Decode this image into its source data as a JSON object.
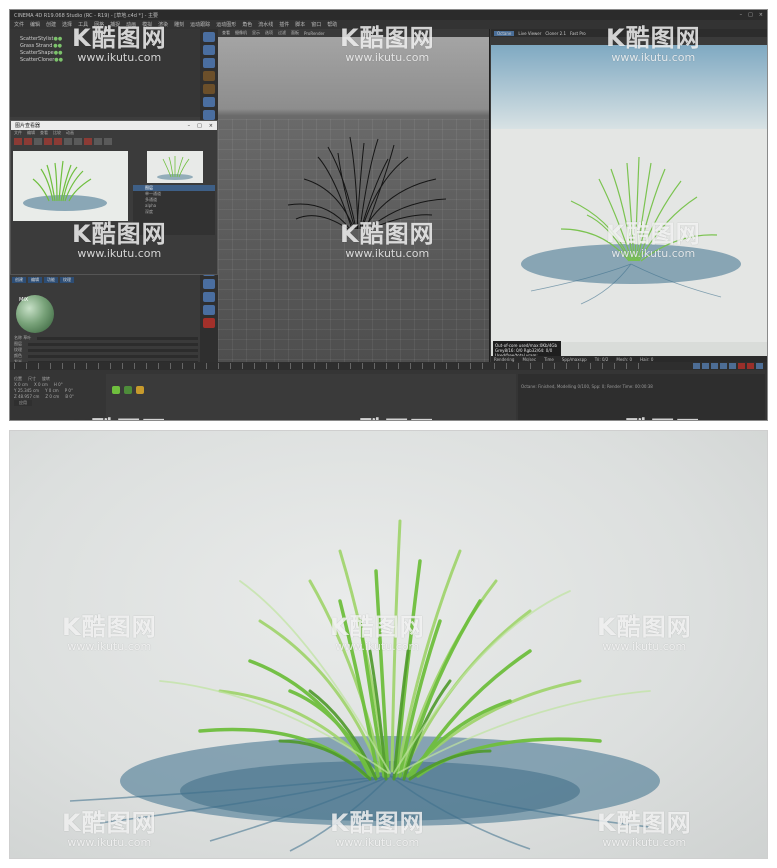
{
  "app": {
    "title": "CINEMA 4D R19.068 Studio (RC - R19) - [草地.c4d *] - 主要",
    "menus": [
      "文件",
      "编辑",
      "创建",
      "选择",
      "工具",
      "网格",
      "捕捉",
      "动画",
      "模拟",
      "渲染",
      "雕刻",
      "运动跟踪",
      "运动图形",
      "角色",
      "流水线",
      "插件",
      "脚本",
      "窗口",
      "帮助"
    ]
  },
  "object_manager": {
    "items": [
      "ScatterStylist",
      "Grass Strand",
      "ScatterShape",
      "ScatterCloner"
    ]
  },
  "picture_viewer": {
    "title": "图片查看器",
    "menu": [
      "文件",
      "编辑",
      "查看",
      "比较",
      "动画"
    ],
    "window_controls": [
      "–",
      "□",
      "×"
    ],
    "list": [
      "图层",
      "单一通道",
      "多通道",
      "alpha",
      "深度"
    ]
  },
  "material": {
    "tabs": [
      "创建",
      "编辑",
      "功能",
      "纹理"
    ],
    "label": "MIX",
    "props": [
      "名称 草叶",
      "图层",
      "纹理",
      "颜色",
      "发光"
    ]
  },
  "viewport": {
    "menu": [
      "查看",
      "摄像机",
      "显示",
      "选项",
      "过滤",
      "面板",
      "ProRender"
    ]
  },
  "render_window": {
    "tabs": [
      "Octane",
      "Live Viewer",
      "Cloner 2.1",
      "Fast Pro"
    ],
    "info_lines": [
      "Out-of-core used/max:0Kb/4Gb",
      "Grey8/16: 0/0      Rgb32/64: 0/0",
      "Used/free/total vram: 5Gb/10Gb/11Gb"
    ],
    "status": [
      "Rendering",
      "Ms/sec",
      "Time",
      "Spp/maxspp",
      "Tri: 0/2",
      "Mesh: 0",
      "Hair: 0"
    ]
  },
  "bottom": {
    "coord_header": [
      "位置",
      "尺寸",
      "旋转"
    ],
    "coords": [
      [
        "X 0 cm",
        "X 0 cm",
        "H 0°"
      ],
      [
        "Y 25.345 cm",
        "Y 0 cm",
        "P 0°"
      ],
      [
        "Z 48.957 cm",
        "Z 0 cm",
        "B 0°"
      ]
    ],
    "apply_button": "应用",
    "console": "Octane: Finished, Modelling 0/100, Spp: 0; Render Time: 00:00:38"
  },
  "watermark": {
    "brand": "K酷图网",
    "url": "www.ikutu.com"
  },
  "colors": {
    "accent": "#4a6e98",
    "grass": "#7bc04a",
    "shadow": "#3d6f8c"
  }
}
